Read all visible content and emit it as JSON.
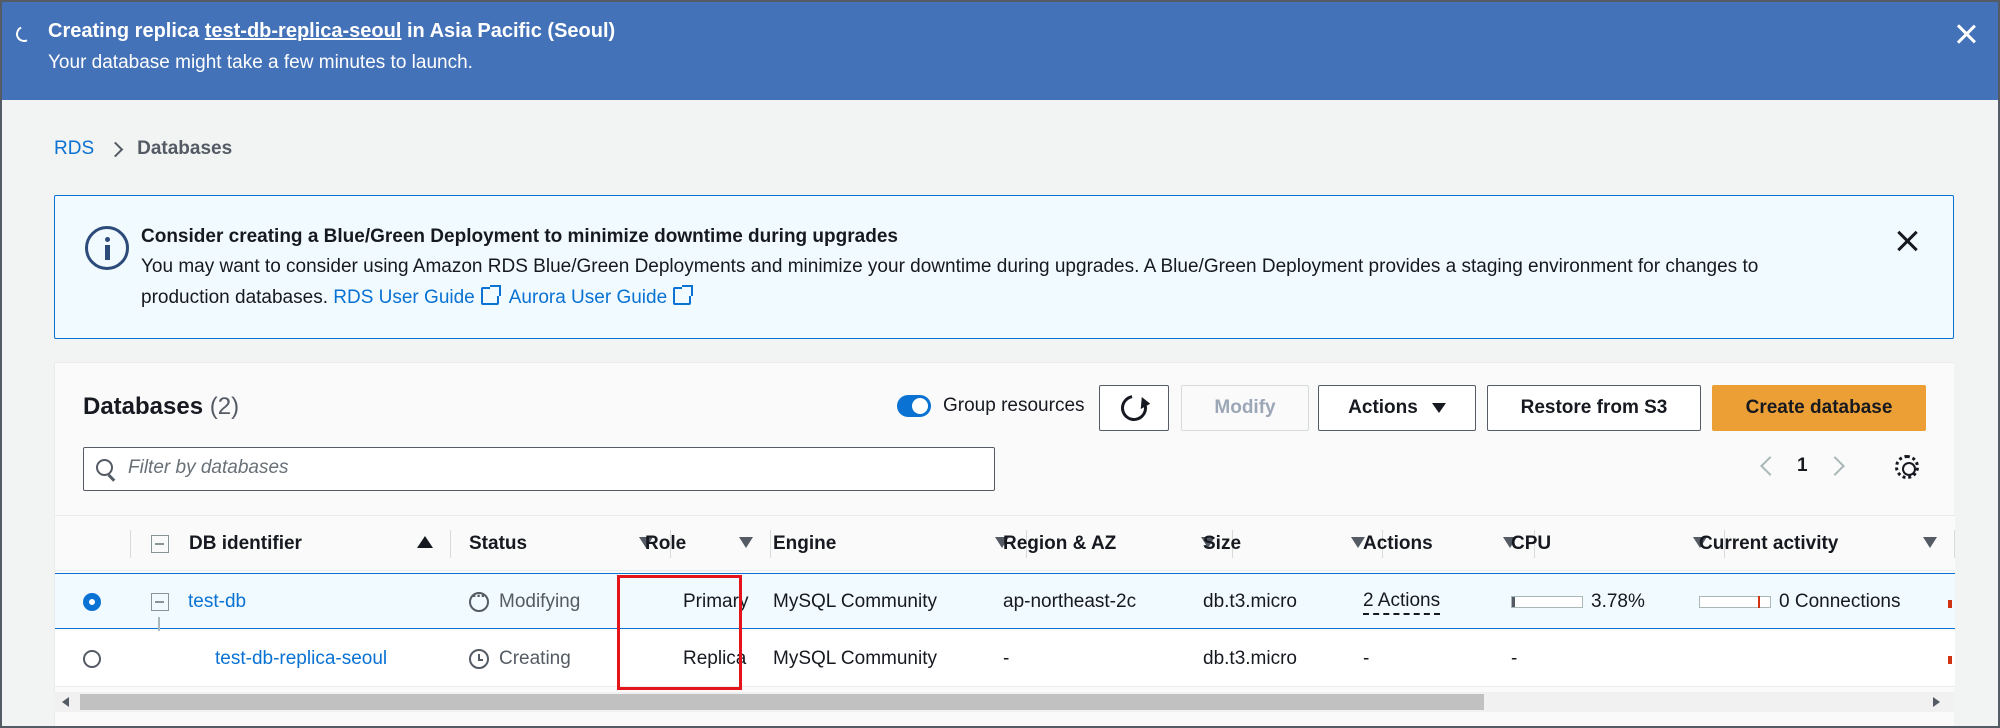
{
  "flash": {
    "prefix": "Creating replica ",
    "replica_name": "test-db-replica-seoul",
    "suffix": " in Asia Pacific (Seoul)",
    "message": "Your database might take a few minutes to launch."
  },
  "breadcrumb": {
    "root": "RDS",
    "current": "Databases"
  },
  "info_alert": {
    "title": "Consider creating a Blue/Green Deployment to minimize downtime during upgrades",
    "body_line1": "You may want to consider using Amazon RDS Blue/Green Deployments and minimize your downtime during upgrades. A Blue/Green Deployment provides a staging environment for changes to",
    "body_line2": "production databases.",
    "link1": "RDS User Guide",
    "link2": "Aurora User Guide"
  },
  "databases": {
    "title": "Databases",
    "count": "(2)",
    "group_resources_label": "Group resources",
    "buttons": {
      "modify": "Modify",
      "actions": "Actions",
      "restore": "Restore from S3",
      "create": "Create database"
    },
    "filter_placeholder": "Filter by databases",
    "page": "1",
    "columns": [
      "DB identifier",
      "Status",
      "Role",
      "Engine",
      "Region & AZ",
      "Size",
      "Actions",
      "CPU",
      "Current activity"
    ],
    "rows": [
      {
        "identifier": "test-db",
        "status": "Modifying",
        "role": "Primary",
        "engine": "MySQL Community",
        "region": "ap-northeast-2c",
        "size": "db.t3.micro",
        "actions": "2 Actions",
        "cpu": "3.78%",
        "cpu_fraction": 0.0378,
        "activity": "0 Connections"
      },
      {
        "identifier": "test-db-replica-seoul",
        "status": "Creating",
        "role": "Replica",
        "engine": "MySQL Community",
        "region": "-",
        "size": "db.t3.micro",
        "actions": "-",
        "cpu": "-"
      }
    ]
  },
  "colors": {
    "flash_bg": "#4472b8",
    "link": "#0972d3",
    "primary_button": "#ec9f35",
    "highlight": "#e4141a"
  }
}
